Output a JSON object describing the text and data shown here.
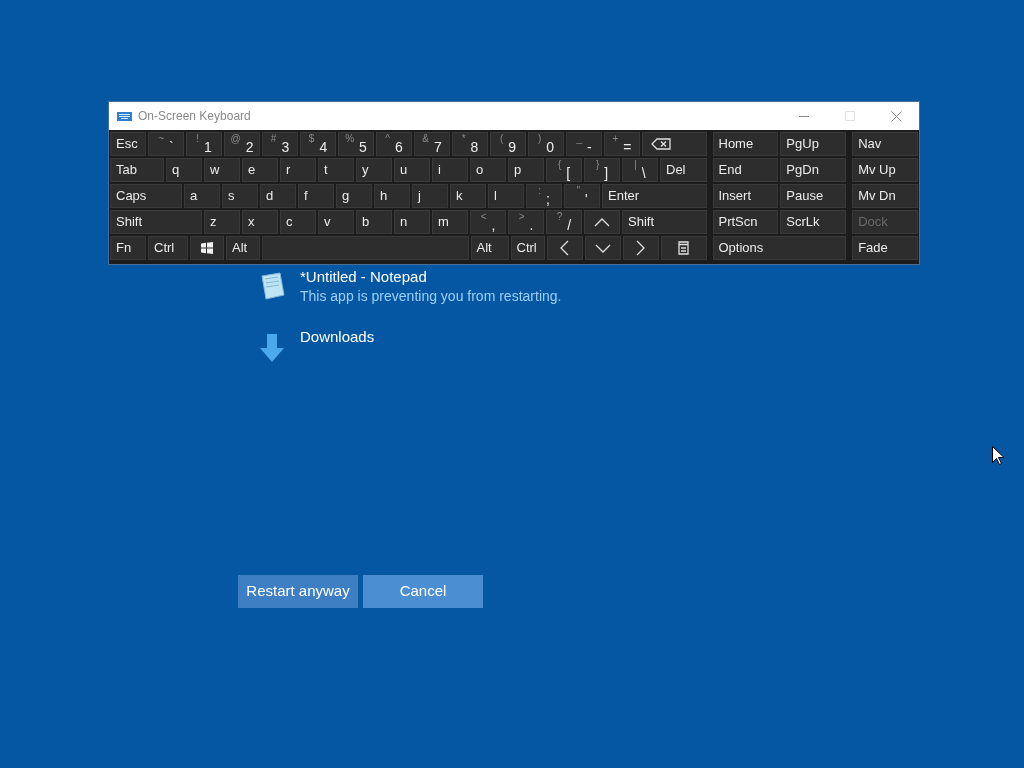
{
  "notepad_item": {
    "title": "*Untitled - Notepad",
    "message": "This app is preventing you from restarting."
  },
  "downloads_item": {
    "title": "Downloads"
  },
  "buttons": [
    {
      "label": "Restart anyway"
    },
    {
      "label": "Cancel"
    }
  ],
  "window": {
    "title": "On-Screen Keyboard",
    "maximize_disabled": true
  },
  "main_rows": [
    [
      {
        "kind": "key",
        "label": "Esc"
      },
      {
        "kind": "key",
        "shift": "~",
        "label": "`"
      },
      {
        "kind": "key",
        "shift": "!",
        "label": "1"
      },
      {
        "kind": "key",
        "shift": "@",
        "label": "2"
      },
      {
        "kind": "key",
        "shift": "#",
        "label": "3"
      },
      {
        "kind": "key",
        "shift": "$",
        "label": "4"
      },
      {
        "kind": "key",
        "shift": "%",
        "label": "5"
      },
      {
        "kind": "key",
        "shift": "^",
        "label": "6"
      },
      {
        "kind": "key",
        "shift": "&",
        "label": "7"
      },
      {
        "kind": "key",
        "shift": "*",
        "label": "8"
      },
      {
        "kind": "key",
        "shift": "(",
        "label": "9"
      },
      {
        "kind": "key",
        "shift": ")",
        "label": "0"
      },
      {
        "kind": "key",
        "shift": "_",
        "label": "-"
      },
      {
        "kind": "key",
        "shift": "+",
        "label": "="
      },
      {
        "kind": "backspace"
      }
    ],
    [
      {
        "kind": "key",
        "label": "Tab"
      },
      {
        "kind": "key",
        "label": "q"
      },
      {
        "kind": "key",
        "label": "w"
      },
      {
        "kind": "key",
        "label": "e"
      },
      {
        "kind": "key",
        "label": "r"
      },
      {
        "kind": "key",
        "label": "t"
      },
      {
        "kind": "key",
        "label": "y"
      },
      {
        "kind": "key",
        "label": "u"
      },
      {
        "kind": "key",
        "label": "i"
      },
      {
        "kind": "key",
        "label": "o"
      },
      {
        "kind": "key",
        "label": "p"
      },
      {
        "kind": "key",
        "shift": "{",
        "label": "["
      },
      {
        "kind": "key",
        "shift": "}",
        "label": "]"
      },
      {
        "kind": "key",
        "shift": "|",
        "label": "\\"
      },
      {
        "kind": "key",
        "label": "Del"
      }
    ],
    [
      {
        "kind": "key",
        "label": "Caps"
      },
      {
        "kind": "key",
        "label": "a"
      },
      {
        "kind": "key",
        "label": "s"
      },
      {
        "kind": "key",
        "label": "d"
      },
      {
        "kind": "key",
        "label": "f"
      },
      {
        "kind": "key",
        "label": "g"
      },
      {
        "kind": "key",
        "label": "h"
      },
      {
        "kind": "key",
        "label": "j"
      },
      {
        "kind": "key",
        "label": "k"
      },
      {
        "kind": "key",
        "label": "l"
      },
      {
        "kind": "key",
        "shift": ":",
        "label": ";"
      },
      {
        "kind": "key",
        "shift": "\"",
        "label": "'"
      },
      {
        "kind": "key",
        "label": "Enter"
      }
    ],
    [
      {
        "kind": "key",
        "label": "Shift"
      },
      {
        "kind": "key",
        "label": "z"
      },
      {
        "kind": "key",
        "label": "x"
      },
      {
        "kind": "key",
        "label": "c"
      },
      {
        "kind": "key",
        "label": "v"
      },
      {
        "kind": "key",
        "label": "b"
      },
      {
        "kind": "key",
        "label": "n"
      },
      {
        "kind": "key",
        "label": "m"
      },
      {
        "kind": "key",
        "shift": "<",
        "label": ","
      },
      {
        "kind": "key",
        "shift": ">",
        "label": "."
      },
      {
        "kind": "key",
        "shift": "?",
        "label": "/"
      },
      {
        "kind": "up"
      },
      {
        "kind": "key",
        "label": "Shift"
      }
    ],
    [
      {
        "kind": "key",
        "label": "Fn"
      },
      {
        "kind": "key",
        "label": "Ctrl"
      },
      {
        "kind": "windows"
      },
      {
        "kind": "key",
        "label": "Alt"
      },
      {
        "kind": "space"
      },
      {
        "kind": "key",
        "label": "Alt"
      },
      {
        "kind": "key",
        "label": "Ctrl"
      },
      {
        "kind": "left"
      },
      {
        "kind": "down"
      },
      {
        "kind": "right"
      },
      {
        "kind": "menu"
      }
    ]
  ],
  "nav_rows": [
    [
      "Home",
      "PgUp"
    ],
    [
      "End",
      "PgDn"
    ],
    [
      "Insert",
      "Pause"
    ],
    [
      "PrtScn",
      "ScrLk"
    ],
    [
      "Options"
    ]
  ],
  "side_keys": [
    {
      "label": "Nav",
      "disabled": false
    },
    {
      "label": "Mv Up",
      "disabled": false
    },
    {
      "label": "Mv Dn",
      "disabled": false
    },
    {
      "label": "Dock",
      "disabled": true
    },
    {
      "label": "Fade",
      "disabled": false
    }
  ]
}
